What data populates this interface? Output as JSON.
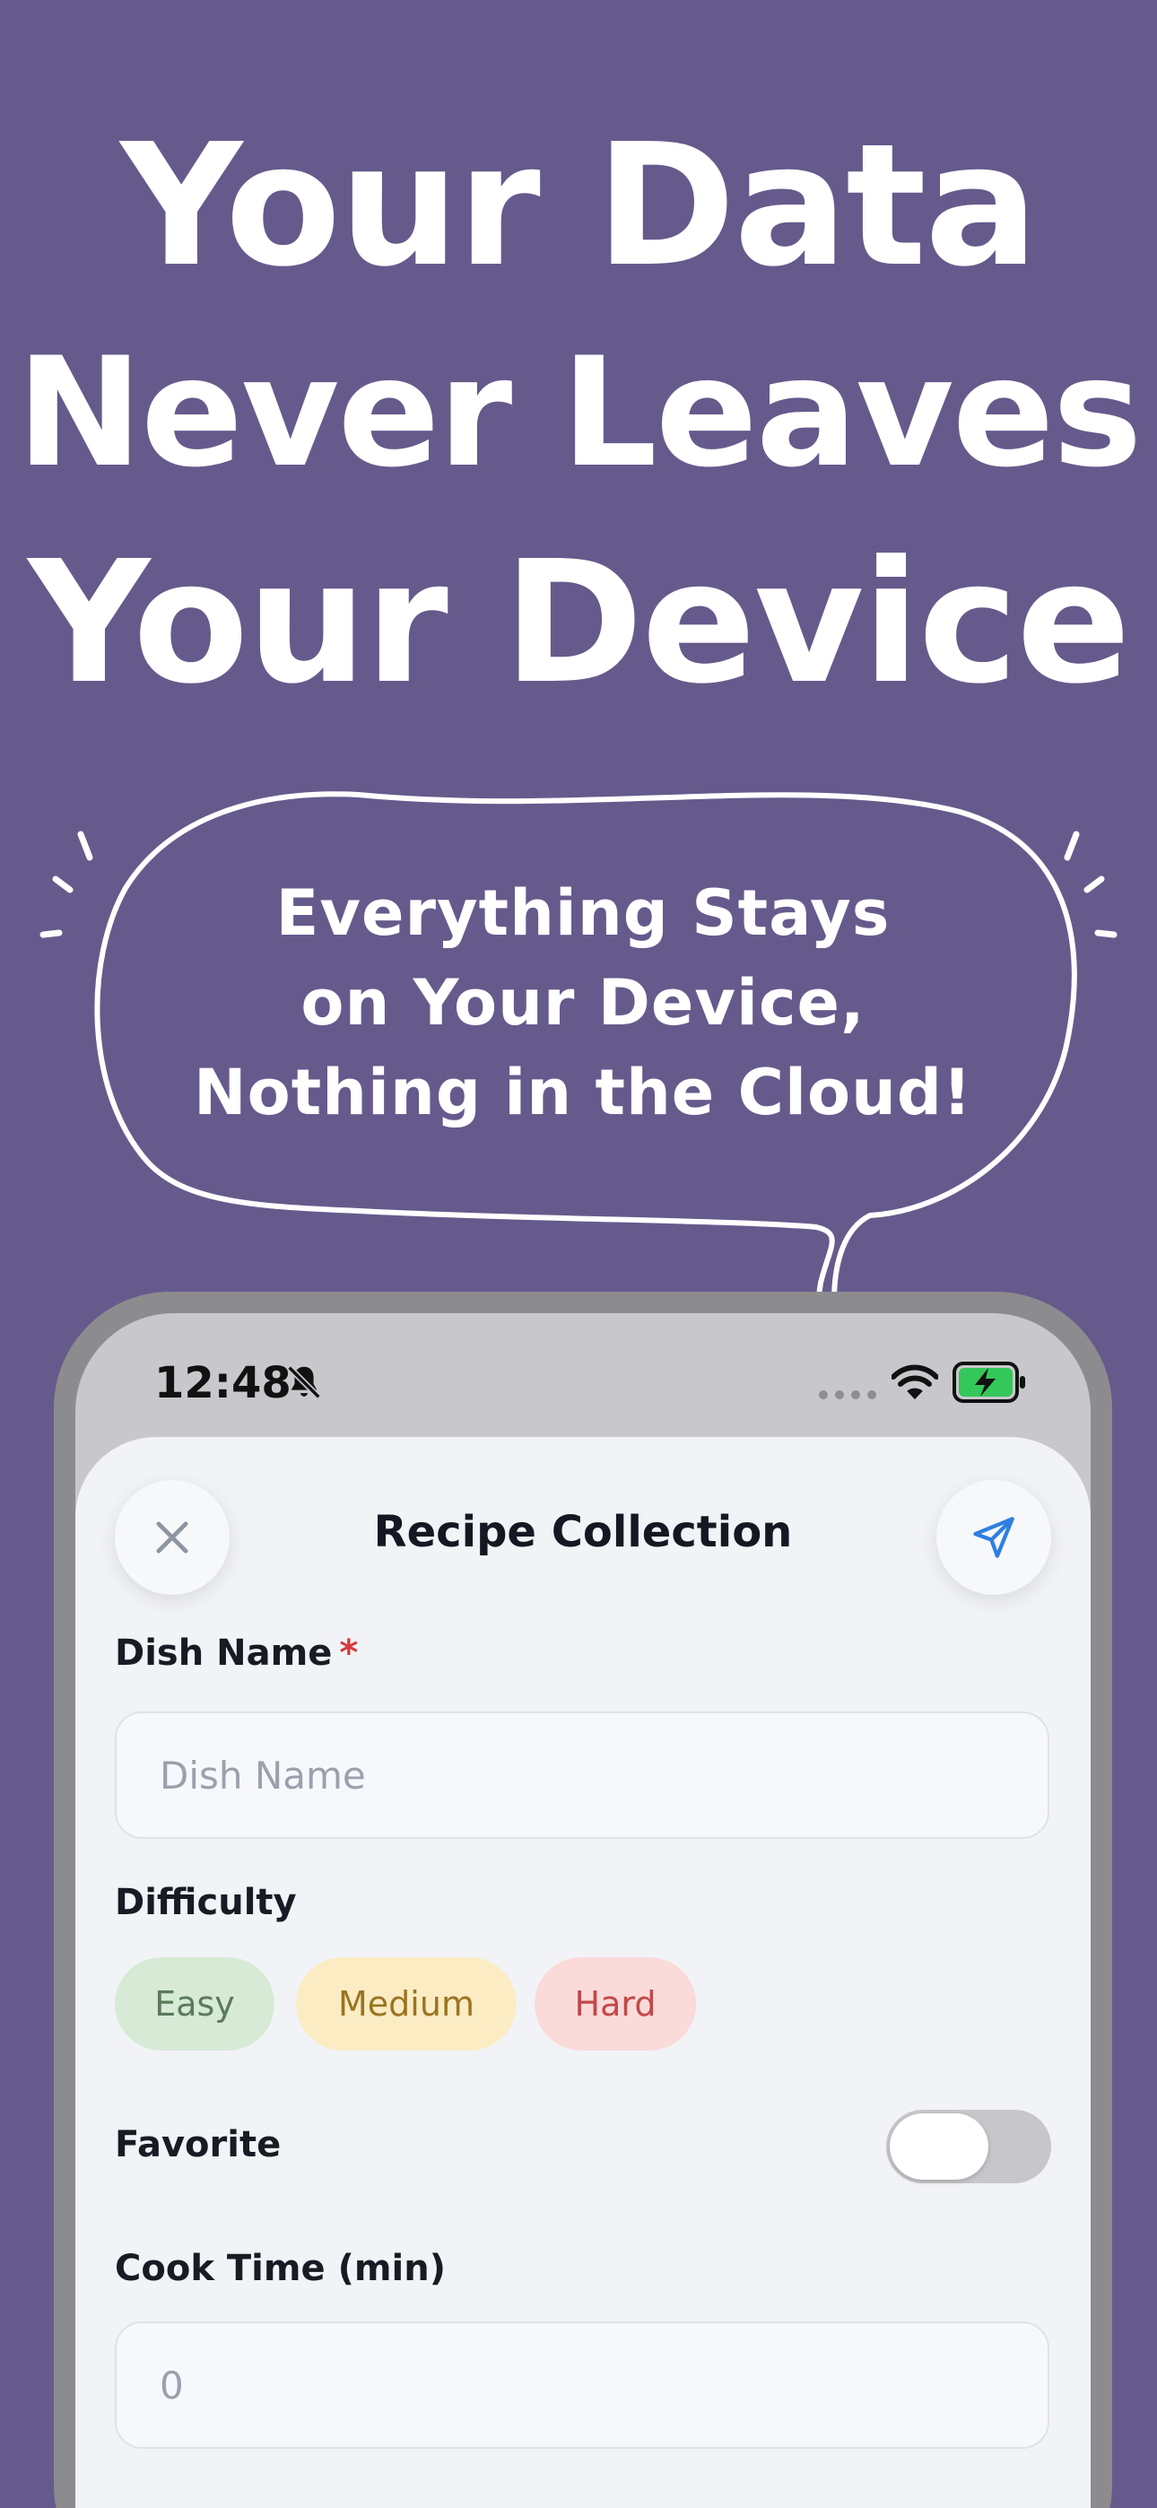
{
  "headline": {
    "line1": "Your Data",
    "line2": "Never Leaves",
    "line3": "Your Device"
  },
  "bubble": {
    "line1": "Everything Stays",
    "line2": "on Your Device,",
    "line3": "Nothing in the Cloud!"
  },
  "status_bar": {
    "time": "12:48"
  },
  "form": {
    "title": "Recipe Collection",
    "dish_name": {
      "label": "Dish Name",
      "required_mark": "*",
      "placeholder": "Dish Name",
      "value": ""
    },
    "difficulty": {
      "label": "Difficulty",
      "options": [
        "Easy",
        "Medium",
        "Hard"
      ]
    },
    "favorite": {
      "label": "Favorite",
      "on": false
    },
    "cook_time": {
      "label": "Cook Time (min)",
      "placeholder": "0",
      "value": ""
    }
  },
  "colors": {
    "background": "#665a8c",
    "accent": "#2f7fe0",
    "required": "#d63a3a",
    "battery": "#34c759"
  }
}
